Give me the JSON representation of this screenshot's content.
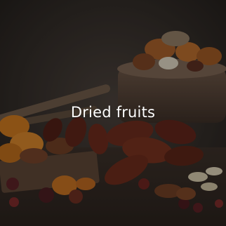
{
  "category_card": {
    "title": "Dried fruits",
    "image_icon": "dried-fruits-photo",
    "colors": {
      "title_text": "#ffffff",
      "dim_overlay": "#000000"
    }
  }
}
